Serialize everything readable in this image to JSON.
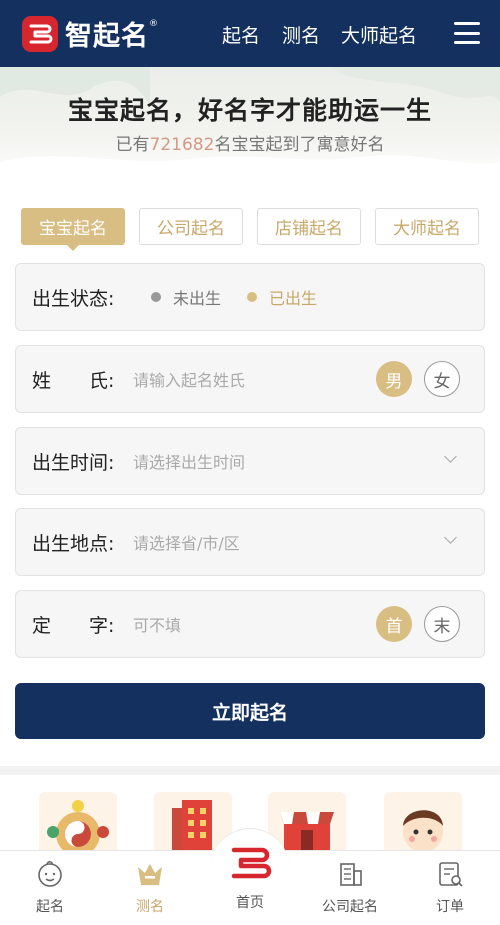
{
  "header": {
    "logo_text": "智起名",
    "logo_reg": "®",
    "nav": [
      "起名",
      "测名",
      "大师起名"
    ]
  },
  "banner": {
    "headline": "宝宝起名，好名字才能助运一生",
    "sub_prefix": "已有",
    "sub_count": "721682",
    "sub_suffix": "名宝宝起到了寓意好名"
  },
  "tabs": [
    {
      "label": "宝宝起名",
      "active": true
    },
    {
      "label": "公司起名",
      "active": false
    },
    {
      "label": "店铺起名",
      "active": false
    },
    {
      "label": "大师起名",
      "active": false
    }
  ],
  "form": {
    "birth_status": {
      "label": "出生状态:",
      "options": [
        {
          "label": "未出生",
          "selected": false
        },
        {
          "label": "已出生",
          "selected": true
        }
      ]
    },
    "surname": {
      "label": "姓　　氏:",
      "placeholder": "请输入起名姓氏",
      "gender_male": "男",
      "gender_female": "女"
    },
    "birth_time": {
      "label": "出生时间:",
      "placeholder": "请选择出生时间"
    },
    "birth_place": {
      "label": "出生地点:",
      "placeholder": "请选择省/市/区"
    },
    "fixed_char": {
      "label": "定　　字:",
      "placeholder": "可不填",
      "first": "首",
      "last": "末"
    },
    "submit_label": "立即起名"
  },
  "bottom_nav": {
    "items": [
      {
        "label": "起名",
        "icon": "baby-face-icon"
      },
      {
        "label": "测名",
        "icon": "crown-icon",
        "active": true
      },
      {
        "label": "首页",
        "icon": "home-logo-icon"
      },
      {
        "label": "公司起名",
        "icon": "building-icon"
      },
      {
        "label": "订单",
        "icon": "order-search-icon"
      }
    ]
  },
  "colors": {
    "navy": "#13305f",
    "gold": "#d9be84",
    "brand_red": "#d8262e"
  }
}
